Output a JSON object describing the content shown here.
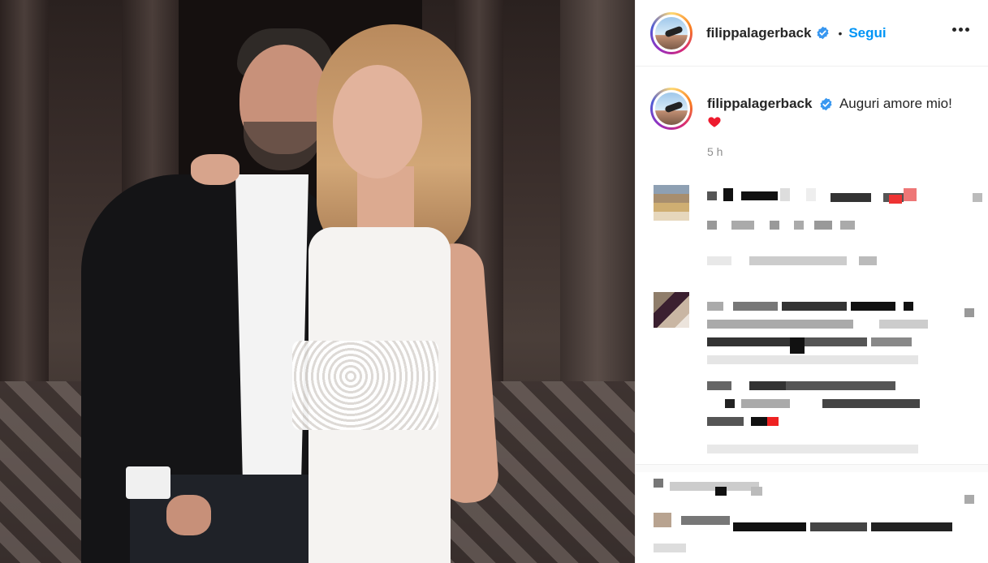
{
  "post": {
    "author": "filippalagerback",
    "follow_label": "Segui",
    "caption_author": "filippalagerback",
    "caption_text": "Auguri amore mio!",
    "caption_emoji": "red-heart",
    "timestamp": "5 h"
  },
  "icons": {
    "verified": "verified-badge-icon",
    "more": "more-options-icon"
  },
  "colors": {
    "follow_blue": "#0095f6",
    "verified_blue": "#3897f0",
    "timestamp_gray": "#8e8e8e",
    "heart_red": "#ed1b2e"
  },
  "comments_note": "Comments are pixelated/blurred in the screenshot"
}
